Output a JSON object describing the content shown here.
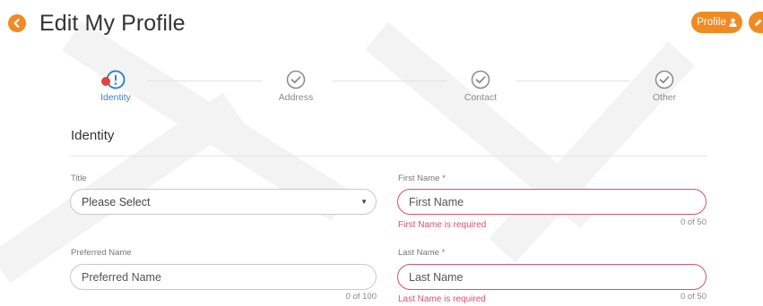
{
  "header": {
    "title": "Edit My Profile",
    "back_icon": "arrow-left-circle-icon",
    "profile_button": "Profile",
    "profile_icon": "user-icon",
    "edge_icon": "pencil-icon",
    "accent_color": "#f08b24"
  },
  "steps": [
    {
      "label": "Identity",
      "state": "error"
    },
    {
      "label": "Address",
      "state": "complete"
    },
    {
      "label": "Contact",
      "state": "complete"
    },
    {
      "label": "Other",
      "state": "complete"
    }
  ],
  "section": {
    "title": "Identity"
  },
  "form": {
    "title": {
      "label": "Title",
      "value": "Please Select"
    },
    "first_name": {
      "label": "First Name *",
      "placeholder": "First Name",
      "error": "First Name is required",
      "counter": "0 of 50"
    },
    "preferred_name": {
      "label": "Preferred Name",
      "placeholder": "Preferred Name",
      "counter": "0 of 100"
    },
    "last_name": {
      "label": "Last Name *",
      "placeholder": "Last Name",
      "error": "Last Name is required",
      "counter": "0 of 50"
    }
  },
  "colors": {
    "active_step": "#3a82c4",
    "error": "#d6536c",
    "error_badge": "#e0443a"
  }
}
